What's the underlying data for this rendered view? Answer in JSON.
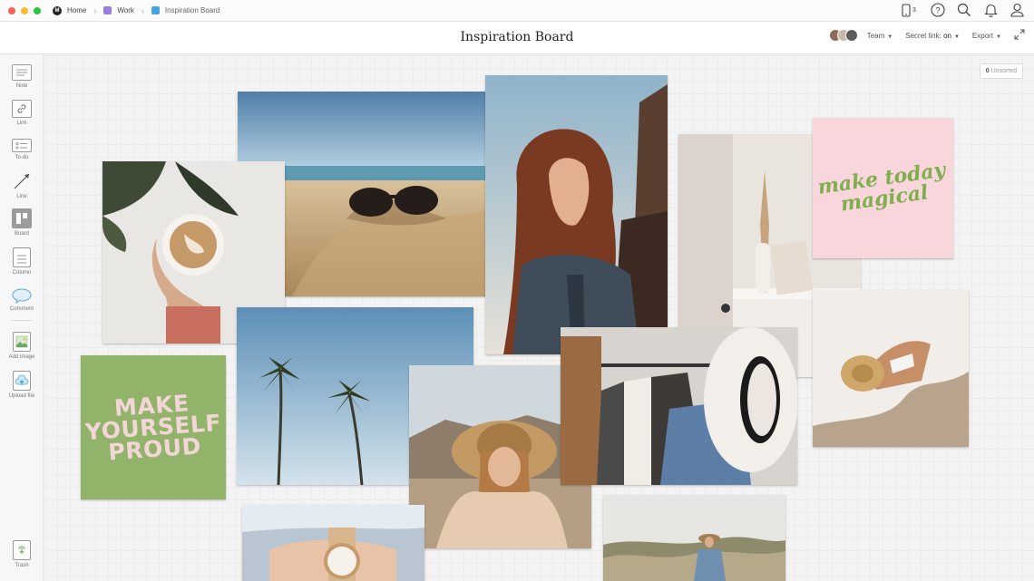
{
  "topbar": {
    "breadcrumbs": [
      {
        "label": "Home",
        "color": "#222222"
      },
      {
        "label": "Work",
        "color": "#9a7fe0"
      },
      {
        "label": "Inspiration Board",
        "color": "#4aa3df"
      }
    ],
    "device_count": "3"
  },
  "titlebar": {
    "title": "Inspiration Board",
    "team_label": "Team",
    "secret_link_label": "Secret link:",
    "secret_link_value": "on",
    "export_label": "Export"
  },
  "toolbar": {
    "note": "Note",
    "link": "Link",
    "todo": "To-do",
    "line": "Line",
    "board": "Board",
    "column": "Column",
    "comment": "Comment",
    "add_image": "Add image",
    "upload_file": "Upload file",
    "trash": "Trash"
  },
  "canvas": {
    "unsorted_count": "0",
    "unsorted_label": "Unsorted",
    "quote_green": "MAKE YOURSELF PROUD",
    "quote_pink": "make today magical"
  },
  "colors": {
    "accent_green": "#92b36a",
    "accent_pink": "#f8d6dc"
  }
}
